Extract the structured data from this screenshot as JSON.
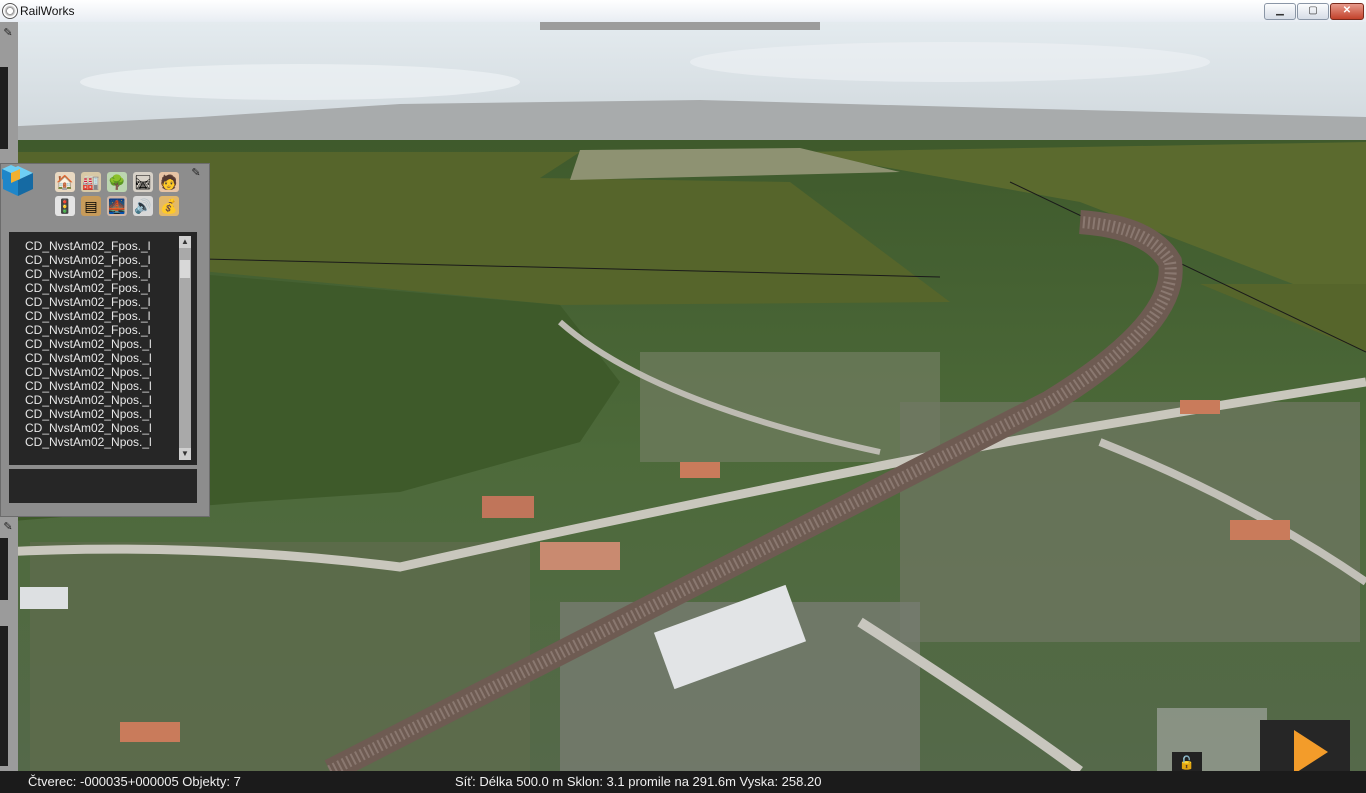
{
  "window": {
    "title": "RailWorks",
    "buttons": {
      "minimize": "▁",
      "maximize": "▢",
      "close": "✕"
    }
  },
  "editor_panel": {
    "tool_icons": [
      "house-icon",
      "industry-icon",
      "tree-icon",
      "track-icon",
      "figure-icon",
      "signal-icon",
      "track-piece-icon",
      "bridge-icon",
      "sound-icon",
      "money-bag-icon"
    ],
    "object_list": [
      "CD_NvstAm02_Fpos._l",
      "CD_NvstAm02_Fpos._l",
      "CD_NvstAm02_Fpos._l",
      "CD_NvstAm02_Fpos._l",
      "CD_NvstAm02_Fpos._l",
      "CD_NvstAm02_Fpos._l",
      "CD_NvstAm02_Fpos._l",
      "CD_NvstAm02_Npos._l",
      "CD_NvstAm02_Npos._l",
      "CD_NvstAm02_Npos._l",
      "CD_NvstAm02_Npos._l",
      "CD_NvstAm02_Npos._l",
      "CD_NvstAm02_Npos._l",
      "CD_NvstAm02_Npos._l",
      "CD_NvstAm02_Npos._l"
    ],
    "scroll_up": "▲",
    "scroll_down": "▼"
  },
  "status": {
    "left": "Čtverec: -000035+000005  Objekty: 7",
    "right": "Síť:  Délka  500.0 m Sklon:  3.1 promile na 291.6m Vyska: 258.20"
  },
  "controls": {
    "lock_icon": "🔓"
  },
  "colors": {
    "sky_top": "#dfe7ec",
    "sky_bottom": "#cfd7dc",
    "mountains": "#a7aaab",
    "flat_terrain": "#56652b",
    "play_orange": "#f39c2a"
  }
}
